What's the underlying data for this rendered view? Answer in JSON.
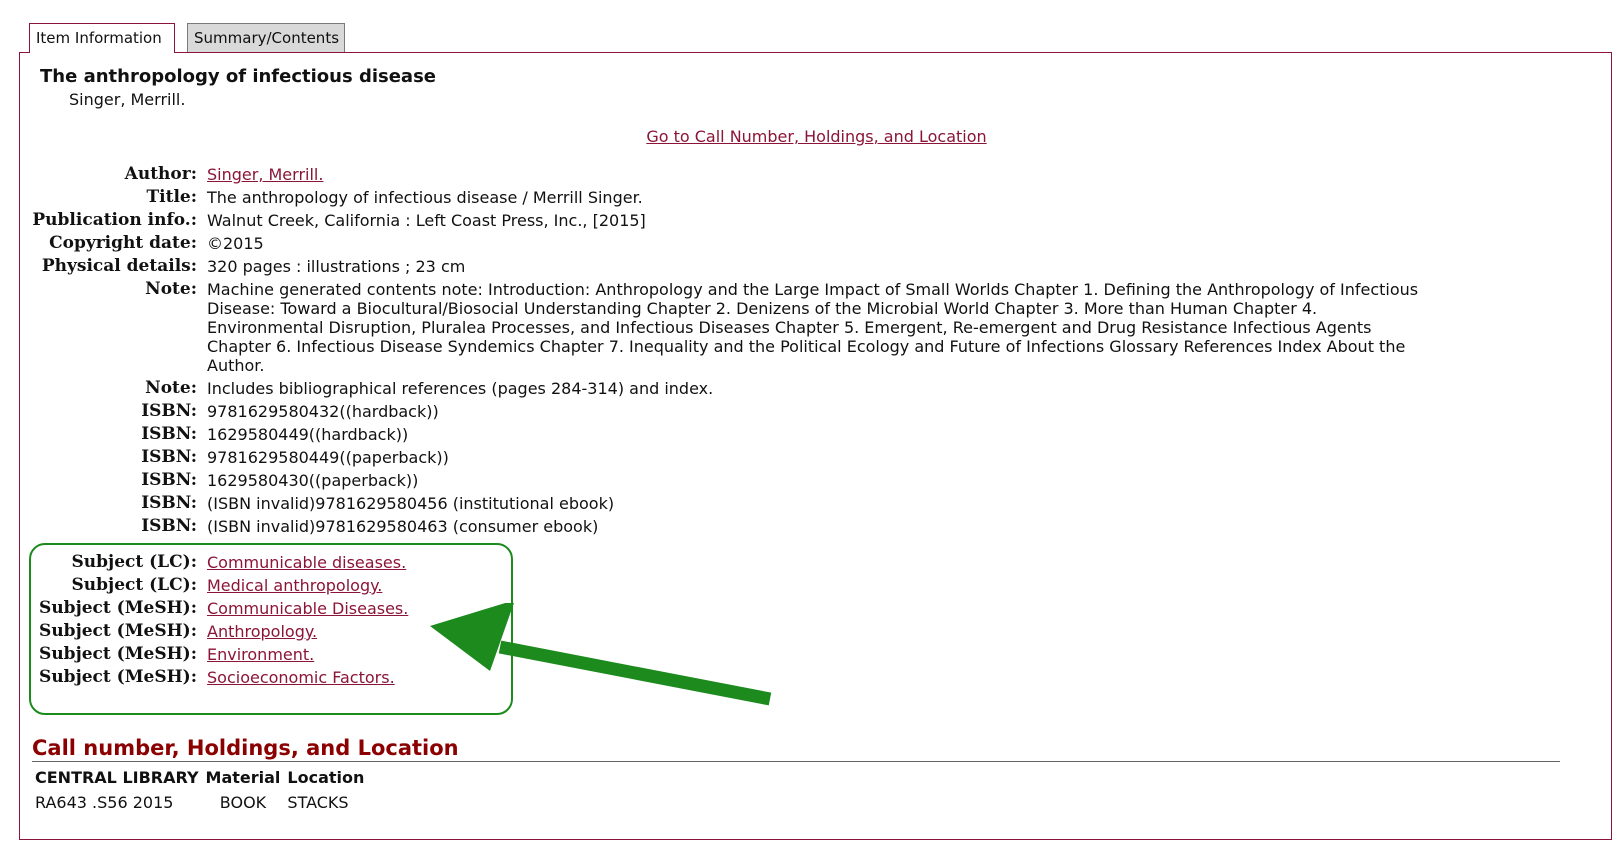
{
  "tabs": [
    {
      "label": "Item Information",
      "active": true
    },
    {
      "label": "Summary/Contents",
      "active": false
    }
  ],
  "item": {
    "title": "The anthropology of infectious disease",
    "author": "Singer, Merrill."
  },
  "goto_link": "Go to Call Number, Holdings, and Location ",
  "fields": [
    {
      "label": "Author:",
      "value": "Singer, Merrill.",
      "link": true
    },
    {
      "label": "Title:",
      "value": "The anthropology of infectious disease / Merrill Singer."
    },
    {
      "label": "Publication info.:",
      "value": "Walnut Creek, California : Left Coast Press, Inc., [2015]"
    },
    {
      "label": "Copyright date:",
      "value": "©2015"
    },
    {
      "label": "Physical details:",
      "value": "320 pages : illustrations ; 23 cm"
    },
    {
      "label": "Note:",
      "value": "Machine generated contents note: Introduction: Anthropology and the Large Impact of Small Worlds Chapter 1. Defining the Anthropology of Infectious Disease: Toward a Biocultural/Biosocial Understanding Chapter 2. Denizens of the Microbial World Chapter 3. More than Human Chapter 4. Environmental Disruption, Pluralea Processes, and Infectious Diseases Chapter 5. Emergent, Re-emergent and Drug Resistance Infectious Agents Chapter 6. Infectious Disease Syndemics Chapter 7. Inequality and the Political Ecology and Future of Infections Glossary References Index About the Author."
    },
    {
      "label": "Note:",
      "value": "Includes bibliographical references (pages 284-314) and index."
    },
    {
      "label": "ISBN:",
      "value": "9781629580432((hardback))"
    },
    {
      "label": "ISBN:",
      "value": "1629580449((hardback))"
    },
    {
      "label": "ISBN:",
      "value": "9781629580449((paperback))"
    },
    {
      "label": "ISBN:",
      "value": "1629580430((paperback))"
    },
    {
      "label": "ISBN:",
      "value": "(ISBN invalid)9781629580456 (institutional ebook)"
    },
    {
      "label": "ISBN:",
      "value": "(ISBN invalid)9781629580463 (consumer ebook)"
    }
  ],
  "subjects": [
    {
      "label": "Subject (LC):",
      "value": "Communicable diseases."
    },
    {
      "label": "Subject (LC):",
      "value": "Medical anthropology."
    },
    {
      "label": "Subject (MeSH):",
      "value": "Communicable Diseases."
    },
    {
      "label": "Subject (MeSH):",
      "value": "Anthropology."
    },
    {
      "label": "Subject (MeSH):",
      "value": "Environment."
    },
    {
      "label": "Subject (MeSH):",
      "value": "Socioeconomic Factors."
    }
  ],
  "holdings": {
    "title": "Call number, Holdings, and Location",
    "headers": [
      "CENTRAL LIBRARY",
      "Material",
      "Location"
    ],
    "rows": [
      [
        "RA643 .S56 2015",
        "BOOK",
        "STACKS"
      ]
    ]
  },
  "colors": {
    "link": "#8b1538",
    "highlight": "#1d8a1d",
    "heading": "#8b0000"
  }
}
